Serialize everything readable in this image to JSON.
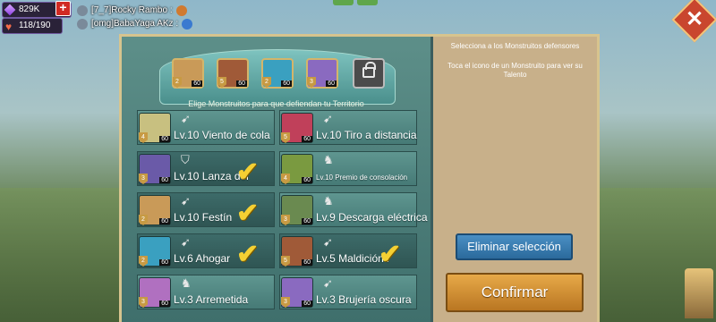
{
  "hud": {
    "gems": "829K",
    "plus": "+",
    "stamina": "118/190"
  },
  "chat": [
    {
      "user": "[7_7]Rocky Rambo :"
    },
    {
      "user": "[omg]BabaYaga AKz :"
    }
  ],
  "panel": {
    "instruction": "Elige Monstruitos para que defiendan tu Territorio",
    "slots": [
      {
        "level": "60",
        "star": "2",
        "color": "#c99a58",
        "locked": false
      },
      {
        "level": "60",
        "star": "5",
        "color": "#a05a38",
        "locked": false
      },
      {
        "level": "60",
        "star": "2",
        "color": "#3aa0c0",
        "locked": false
      },
      {
        "level": "60",
        "star": "3",
        "color": "#8a6ac0",
        "locked": false
      },
      {
        "level": "",
        "star": "",
        "color": "#4b4b4b",
        "locked": true
      }
    ],
    "monsters": [
      {
        "label": "Lv.10 Viento de cola",
        "type": "bow",
        "level": "60",
        "star": "4",
        "color": "#c8c080",
        "selected": false,
        "small": false
      },
      {
        "label": "Lv.10 Tiro a distancia",
        "type": "bow",
        "level": "60",
        "star": "5",
        "color": "#c0405a",
        "selected": false,
        "small": false
      },
      {
        "label": "Lv.10 Lanza del ",
        "type": "shield",
        "level": "60",
        "star": "3",
        "color": "#6a5aa8",
        "selected": true,
        "small": false
      },
      {
        "label": "Lv.10 Premio de consolación",
        "type": "horse",
        "level": "60",
        "star": "4",
        "color": "#7a9a40",
        "selected": false,
        "small": true
      },
      {
        "label": "Lv.10 Festín",
        "type": "bow",
        "level": "60",
        "star": "2",
        "color": "#c99a58",
        "selected": true,
        "small": false
      },
      {
        "label": "Lv.9 Descarga eléctrica",
        "type": "horse",
        "level": "60",
        "star": "3",
        "color": "#6a8a50",
        "selected": false,
        "small": false
      },
      {
        "label": "Lv.6 Ahogar",
        "type": "bow",
        "level": "60",
        "star": "2",
        "color": "#3aa0c0",
        "selected": true,
        "small": false
      },
      {
        "label": "Lv.5 Maldición i",
        "type": "bow",
        "level": "60",
        "star": "5",
        "color": "#a05a38",
        "selected": true,
        "small": false
      },
      {
        "label": "Lv.3 Arremetida",
        "type": "horse",
        "level": "60",
        "star": "3",
        "color": "#b070c0",
        "selected": false,
        "small": false
      },
      {
        "label": "Lv.3 Brujería oscura",
        "type": "bow",
        "level": "60",
        "star": "3",
        "color": "#8a6ac0",
        "selected": false,
        "small": false
      }
    ]
  },
  "side": {
    "title": "Selecciona a los Monstruitos defensores",
    "hint": "Toca el icono de un Monstruito para ver su Talento",
    "clear_label": "Eliminar selección",
    "confirm_label": "Confirmar"
  },
  "icons": {
    "check": "✔",
    "close": "✕",
    "bow": "➹",
    "shield": "⛉",
    "horse": "♞"
  }
}
